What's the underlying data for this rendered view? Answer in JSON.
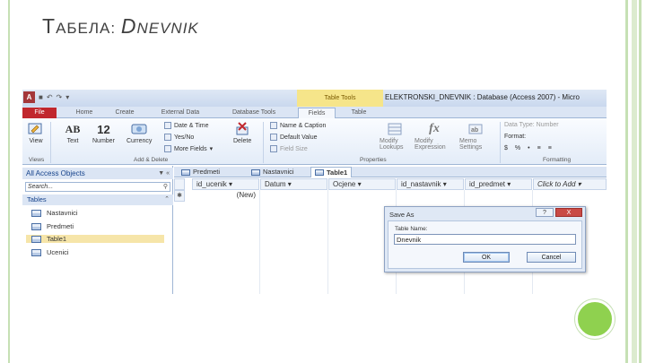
{
  "slide": {
    "title_first": "Т",
    "title_rest": "АБЕЛА: ",
    "title_d": "D",
    "title_nevnik": "NEVNIK"
  },
  "window": {
    "title": "ELEKTRONSKI_DNEVNIK : Database (Access 2007) - Micro",
    "app_icon": "A",
    "context_tab": "Table Tools"
  },
  "ribbon_tabs": [
    "File",
    "Home",
    "Create",
    "External Data",
    "Database Tools",
    "Fields",
    "Table"
  ],
  "ribbon": {
    "view": "View",
    "text": "Text",
    "number": "Number",
    "currency": "Currency",
    "date_time": "Date & Time",
    "yes_no": "Yes/No",
    "more_fields": "More Fields",
    "delete": "Delete",
    "name_caption": "Name & Caption",
    "default_value": "Default Value",
    "field_size": "Field Size",
    "modify_lookups": "Modify Lookups",
    "modify_expression": "Modify Expression",
    "memo_settings": "Memo Settings",
    "data_type": "Data Type: Number",
    "format": "Format:",
    "groups": {
      "views": "Views",
      "add_delete": "Add & Delete",
      "properties": "Properties",
      "formatting": "Formatting"
    },
    "icons": {
      "text_glyph": "AB",
      "number_glyph": "12",
      "dollar": "$",
      "percent": "%"
    }
  },
  "nav": {
    "header": "All Access Objects",
    "search_placeholder": "Search...",
    "group": "Tables",
    "items": [
      "Nastavnici",
      "Predmeti",
      "Table1",
      "Ucenici"
    ]
  },
  "doc_tabs": [
    "Predmeti",
    "Nastavnici",
    "Table1"
  ],
  "grid": {
    "columns": [
      "id_ucenik",
      "Datum",
      "Ocjene",
      "id_nastavnik",
      "id_predmet",
      "Click to Add"
    ],
    "new_row": "(New)"
  },
  "dialog": {
    "title": "Save As",
    "label": "Table Name:",
    "value": "Dnevnik",
    "ok": "OK",
    "cancel": "Cancel",
    "help": "?",
    "close": "X"
  }
}
